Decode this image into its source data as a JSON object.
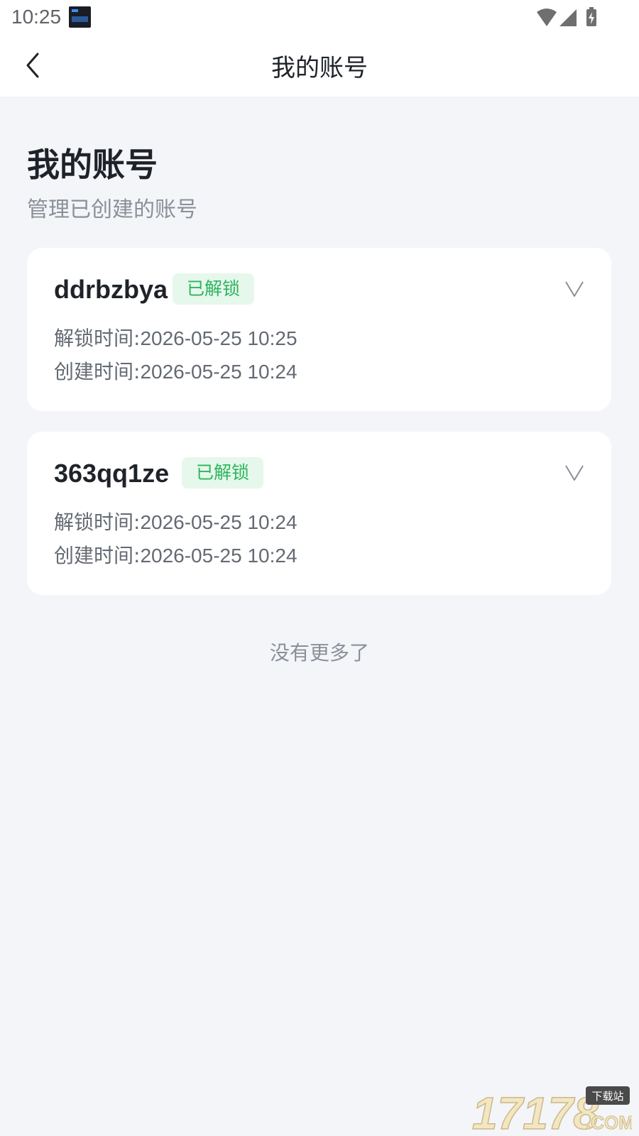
{
  "status_bar": {
    "time": "10:25",
    "app_icon": "clock-widget-icon",
    "icons": [
      "wifi-icon",
      "signal-icon",
      "battery-charging-icon"
    ]
  },
  "header": {
    "title": "我的账号",
    "back_icon": "chevron-left-icon"
  },
  "page": {
    "title": "我的账号",
    "subtitle": "管理已创建的账号"
  },
  "accounts": [
    {
      "name": "ddrbzbya",
      "status": "已解锁",
      "unlock_label": "解锁时间:",
      "unlock_time": "2026-05-25 10:25",
      "created_label": "创建时间:",
      "created_time": "2026-05-25 10:24"
    },
    {
      "name": "363qq1ze",
      "status": "已解锁",
      "unlock_label": "解锁时间:",
      "unlock_time": "2026-05-25 10:24",
      "created_label": "创建时间:",
      "created_time": "2026-05-25 10:24"
    }
  ],
  "list_end_text": "没有更多了",
  "watermark": {
    "text": "17178",
    "badge": "下载站",
    "suffix": ".COM"
  },
  "colors": {
    "background": "#f4f5f9",
    "card": "#ffffff",
    "badge_bg": "#e6f7ec",
    "badge_text": "#2db55d",
    "muted_text": "#8a9099"
  }
}
